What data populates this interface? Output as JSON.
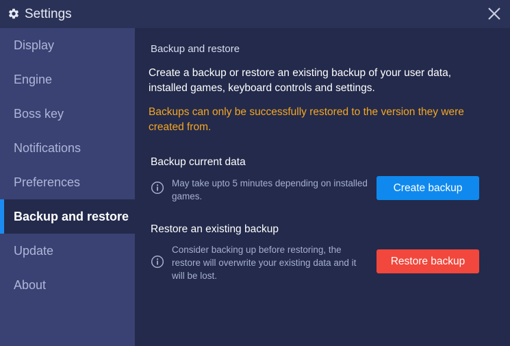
{
  "window": {
    "title": "Settings",
    "title_icon": "gear-icon",
    "close_icon": "close-icon"
  },
  "sidebar": {
    "items": [
      {
        "label": "Display"
      },
      {
        "label": "Engine"
      },
      {
        "label": "Boss key"
      },
      {
        "label": "Notifications"
      },
      {
        "label": "Preferences"
      },
      {
        "label": "Backup and restore",
        "active": true
      },
      {
        "label": "Update"
      },
      {
        "label": "About"
      }
    ]
  },
  "main": {
    "section_title": "Backup and restore",
    "description": "Create a backup or restore an existing backup of your user data, installed games, keyboard controls and settings.",
    "warning": "Backups can only be successfully restored to the version they were created from.",
    "backup": {
      "title": "Backup current data",
      "info": "May take upto 5 minutes depending on installed games.",
      "button_label": "Create backup"
    },
    "restore": {
      "title": "Restore an existing backup",
      "info": "Consider backing up before restoring, the restore will overwrite your existing data and it will be lost.",
      "button_label": "Restore backup"
    }
  },
  "colors": {
    "background": "#232a4b",
    "sidebar": "#3a4273",
    "titlebar": "#2b3257",
    "accent_blue": "#0f89ee",
    "danger_red": "#f2473c",
    "warning_orange": "#f6a623"
  }
}
